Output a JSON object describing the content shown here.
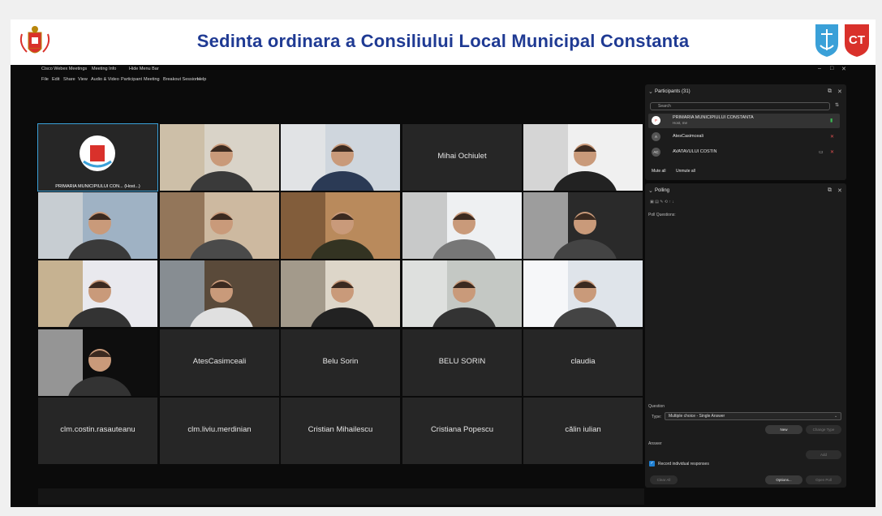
{
  "banner": {
    "title": "Sedinta ordinara a Consiliului Local Municipal Constanta",
    "crest_label": "CONSTANTA",
    "ct_logo": "CT",
    "colors": {
      "title": "#1f3a93",
      "ct_red": "#d9312b",
      "blue_logo": "#3aa0d8"
    }
  },
  "titlebar": {
    "app_name": "Cisco Webex Meetings",
    "meeting_info": "Meeting Info",
    "hide_menu": "Hide Menu Bar"
  },
  "menu": [
    "File",
    "Edit",
    "Share",
    "View",
    "Audio & Video",
    "Participant",
    "Meeting",
    "Breakout Sessions",
    "Help"
  ],
  "grid": {
    "tiles": [
      {
        "name": "PRIMARIA MUNICIPIULUI CON... (Host...)",
        "kind": "logo"
      },
      {
        "name": "",
        "kind": "video"
      },
      {
        "name": "",
        "kind": "video"
      },
      {
        "name": "Mihai Ochiulet",
        "kind": "name"
      },
      {
        "name": "",
        "kind": "video"
      },
      {
        "name": "",
        "kind": "video"
      },
      {
        "name": "",
        "kind": "video"
      },
      {
        "name": "",
        "kind": "video"
      },
      {
        "name": "",
        "kind": "video"
      },
      {
        "name": "",
        "kind": "video"
      },
      {
        "name": "",
        "kind": "video"
      },
      {
        "name": "",
        "kind": "video"
      },
      {
        "name": "",
        "kind": "video"
      },
      {
        "name": "",
        "kind": "video"
      },
      {
        "name": "",
        "kind": "video"
      },
      {
        "name": "",
        "kind": "video"
      },
      {
        "name": "AtesCasimceali",
        "kind": "name"
      },
      {
        "name": "Belu Sorin",
        "kind": "name"
      },
      {
        "name": "BELU SORIN",
        "kind": "name"
      },
      {
        "name": "claudia",
        "kind": "name"
      },
      {
        "name": "clm.costin.rasauteanu",
        "kind": "name"
      },
      {
        "name": "clm.liviu.merdinian",
        "kind": "name"
      },
      {
        "name": "Cristian Mihailescu",
        "kind": "name"
      },
      {
        "name": "Cristiana Popescu",
        "kind": "name"
      },
      {
        "name": "călin iulian",
        "kind": "name"
      }
    ]
  },
  "participants": {
    "header": "Participants (31)",
    "search_placeholder": "Search",
    "rows": [
      {
        "avatar": "P",
        "name": "PRIMARIA MUNICIPIULUI CONSTANTA",
        "sub": "Host, me"
      },
      {
        "avatar": "A",
        "name": "AtesCasimceali",
        "sub": ""
      },
      {
        "avatar": "AC",
        "name": "AVATAVULUI COSTIN",
        "sub": ""
      }
    ],
    "mute_all": "Mute all",
    "unmute_all": "Unmute all"
  },
  "polling": {
    "header": "Polling",
    "poll_questions": "Poll Questions:",
    "question_label": "Question",
    "type_label": "Type:",
    "type_value": "Multiple choice - Single Answer",
    "new_btn": "New",
    "change_type_btn": "Change Type",
    "answer_label": "Answer",
    "add_btn": "Add",
    "record_label": "Record individual responses",
    "clear_all": "Clear All",
    "options": "Options...",
    "open_poll": "Open Poll"
  }
}
